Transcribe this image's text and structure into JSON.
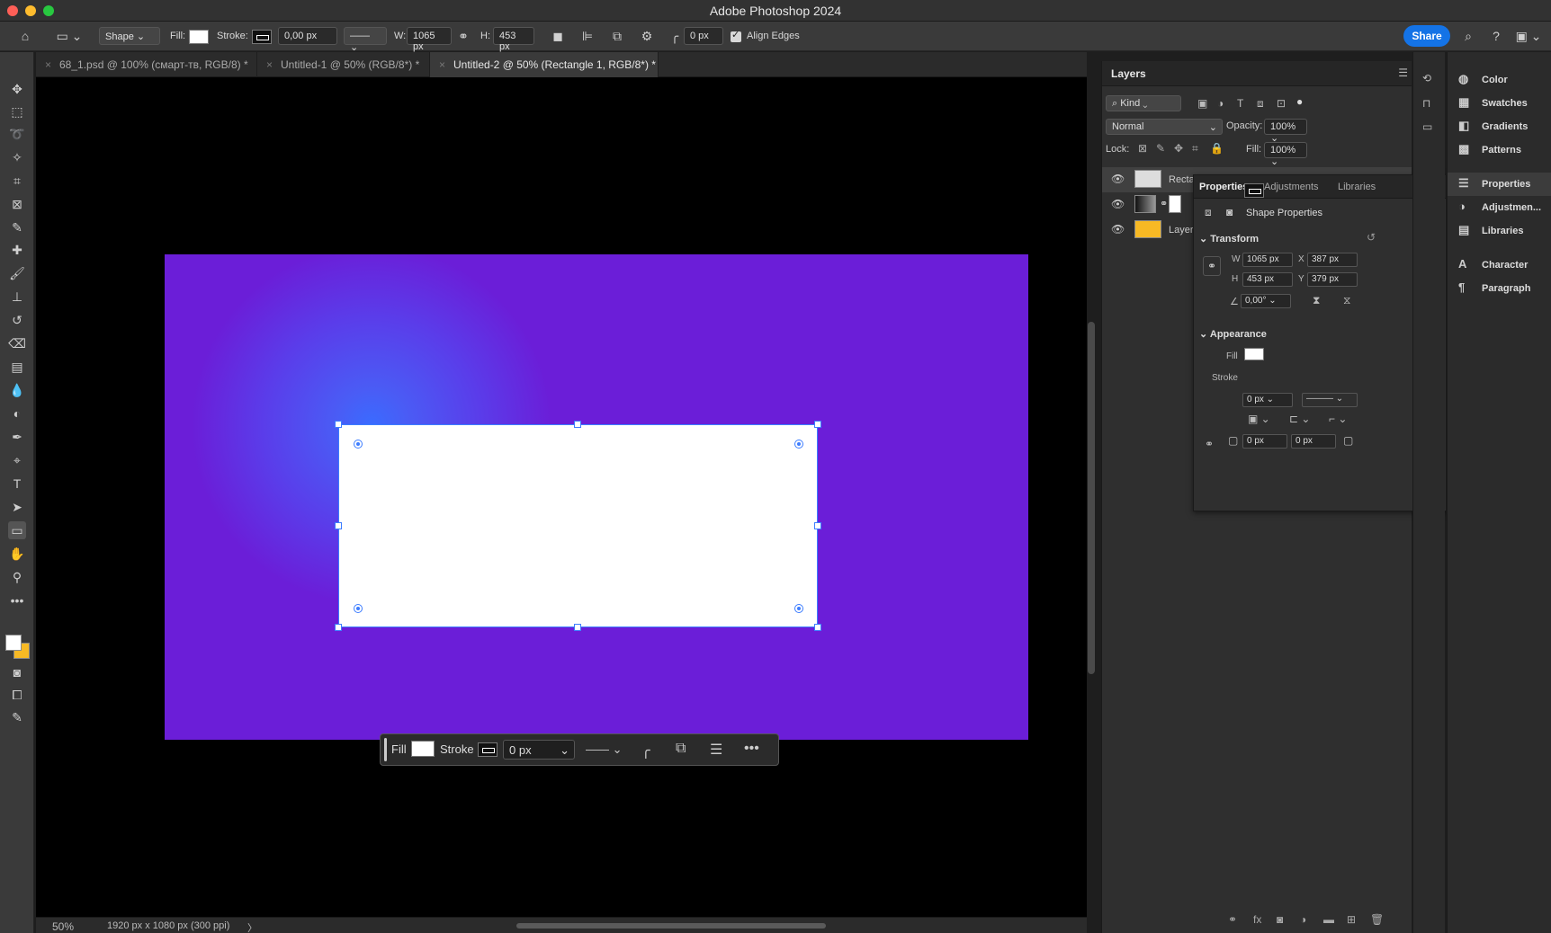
{
  "app": {
    "title": "Adobe Photoshop 2024",
    "traffic_colors": [
      "#fe5f57",
      "#febc2e",
      "#28c840"
    ]
  },
  "options_bar": {
    "tool_mode": "Shape",
    "fill_label": "Fill:",
    "stroke_label": "Stroke:",
    "stroke_width": "0,00 px",
    "width_label": "W:",
    "width_value": "1065 px",
    "height_label": "H:",
    "height_value": "453 px",
    "radius_value": "0 px",
    "align_edges_label": "Align Edges",
    "share_label": "Share"
  },
  "tabs": [
    {
      "label": "68_1.psd @ 100% (смарт-тв, RGB/8) *"
    },
    {
      "label": "Untitled-1 @ 50% (RGB/8*) *"
    },
    {
      "label": "Untitled-2 @ 50% (Rectangle 1, RGB/8*) *"
    }
  ],
  "context_bar": {
    "fill_label": "Fill",
    "stroke_label": "Stroke",
    "stroke_width": "0 px"
  },
  "status": {
    "zoom": "50%",
    "doc_info": "1920 px x 1080 px (300 ppi)"
  },
  "layers_panel": {
    "title": "Layers",
    "kind_label": "Kind",
    "blend_mode": "Normal",
    "opacity_label": "Opacity:",
    "opacity_value": "100%",
    "lock_label": "Lock:",
    "fill_label": "Fill:",
    "fill_value": "100%",
    "layers": [
      {
        "name": "Recta"
      },
      {
        "name": ""
      },
      {
        "name": "Layer"
      }
    ]
  },
  "properties": {
    "tabs": [
      "Properties",
      "Adjustments",
      "Libraries"
    ],
    "subtitle": "Shape Properties",
    "transform_title": "Transform",
    "w_label": "W",
    "w_value": "1065 px",
    "x_label": "X",
    "x_value": "387 px",
    "h_label": "H",
    "h_value": "453 px",
    "y_label": "Y",
    "y_value": "379 px",
    "angle_value": "0,00°",
    "appearance_title": "Appearance",
    "fill_label": "Fill",
    "stroke_label": "Stroke",
    "stroke_width": "0 px",
    "corner_a": "0 px",
    "corner_b": "0 px"
  },
  "right_panels": [
    {
      "label": "Color",
      "icon": "color-wheel-icon"
    },
    {
      "label": "Swatches",
      "icon": "swatches-grid-icon"
    },
    {
      "label": "Gradients",
      "icon": "gradient-icon"
    },
    {
      "label": "Patterns",
      "icon": "patterns-icon"
    },
    {
      "label": "Properties",
      "icon": "sliders-icon"
    },
    {
      "label": "Adjustmen...",
      "icon": "adjustment-icon"
    },
    {
      "label": "Libraries",
      "icon": "library-icon"
    },
    {
      "label": "Character",
      "icon": "character-icon"
    },
    {
      "label": "Paragraph",
      "icon": "paragraph-icon"
    }
  ],
  "colors": {
    "artboard": "#6b1ed8",
    "glow": "#3a6bff",
    "accent": "#1473e6",
    "layer_color_fill": "#f7b924"
  }
}
